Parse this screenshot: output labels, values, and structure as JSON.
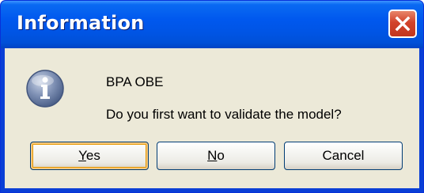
{
  "window": {
    "title": "Information"
  },
  "message": {
    "app_name": "BPA OBE",
    "question": "Do you first want to validate the model?"
  },
  "buttons": {
    "yes": {
      "mnemonic": "Y",
      "rest": "es"
    },
    "no": {
      "mnemonic": "N",
      "rest": "o"
    },
    "cancel": {
      "label": "Cancel"
    }
  },
  "icons": {
    "title_close": "close-icon",
    "message": "information-icon"
  },
  "colors": {
    "titlebar": "#0054e3",
    "close_button": "#d2432b",
    "client_background": "#ece9d8",
    "default_button_highlight": "#f5c77c"
  }
}
